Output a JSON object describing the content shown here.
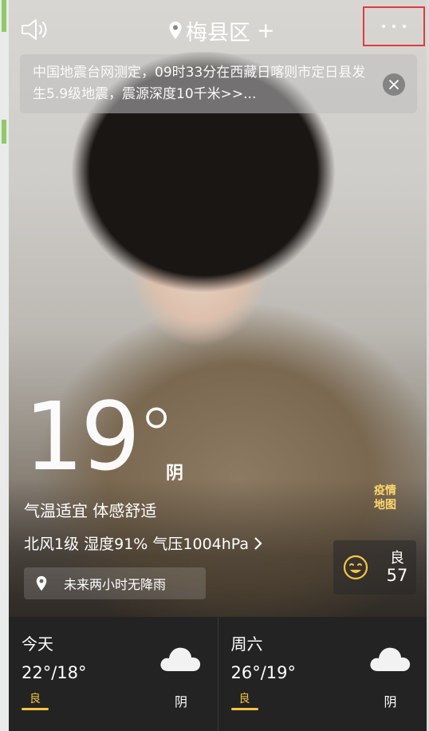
{
  "header": {
    "location": "梅县区",
    "add_label": "+"
  },
  "notice": {
    "text": "中国地震台网测定，09时33分在西藏日喀则市定日县发生5.9级地震，震源深度10千米>>..."
  },
  "current": {
    "temperature": "19",
    "degree_sign": "°",
    "condition": "阴",
    "comfort": "气温适宜 体感舒适",
    "details": "北风1级 湿度91% 气压1004hPa",
    "rain_hint": "未来两小时无降雨"
  },
  "epidemic_map": {
    "line1": "疫情",
    "line2": "地图"
  },
  "air_quality": {
    "level": "良",
    "value": "57"
  },
  "forecast": [
    {
      "day": "今天",
      "range": "22°/18°",
      "quality": "良",
      "condition": "阴",
      "icon": "cloud-icon"
    },
    {
      "day": "周六",
      "range": "26°/19°",
      "quality": "良",
      "condition": "阴",
      "icon": "cloud-icon"
    }
  ],
  "colors": {
    "quality_yellow": "#f5c542",
    "highlight_red": "#e23b3b",
    "forecast_bg": "#232323"
  },
  "icons": {
    "sound": "speaker-icon",
    "location": "location-pin-icon",
    "more": "more-dots-icon",
    "close": "close-icon",
    "rain": "location-pin-icon",
    "air": "smiling-face-icon",
    "details_arrow": "chevron-right-icon"
  }
}
